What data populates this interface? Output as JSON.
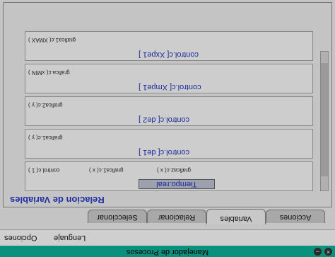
{
  "window": {
    "title": "Manejador de Procesos"
  },
  "menu": {
    "items": [
      "Opciones",
      "Lenguaje"
    ]
  },
  "tabs": [
    {
      "label": "Seleccionar",
      "active": false
    },
    {
      "label": "Relacionar",
      "active": false
    },
    {
      "label": "Variables",
      "active": true
    },
    {
      "label": "Acciones",
      "active": false
    }
  ],
  "panel": {
    "section_title": "Relacion de Variables",
    "rows": [
      {
        "variable": "Tiempo.real",
        "prefix": "Tiempo.[",
        "suffix": "]",
        "vars": [
          "graficaz.c( x )",
          "grafica1.c( x )",
          "control.c( 1 )"
        ]
      },
      {
        "variable": "control.c[ de1 ]",
        "vars": [
          "grafica1.c( y )"
        ]
      },
      {
        "variable": "control.c[ de2 ]",
        "vars": [
          "grafica2.c( y )"
        ]
      },
      {
        "variable": "control.c[ Xmpe1 ]",
        "vars": [
          "grafica.c( xMIN )"
        ]
      },
      {
        "variable": "control.c[ Xxpe1 ]",
        "vars": [
          "grafica1.c( XMAX )"
        ]
      }
    ]
  },
  "colors": {
    "titlebar": "#08927e",
    "accent_text": "#1f2fa3"
  }
}
